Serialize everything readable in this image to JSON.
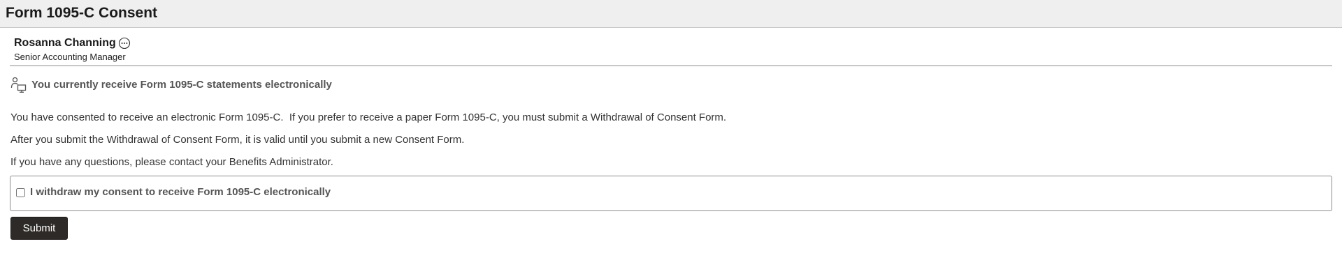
{
  "page": {
    "title": "Form 1095-C Consent"
  },
  "employee": {
    "name": "Rosanna Channing",
    "job_title": "Senior Accounting Manager",
    "more_icon": "ellipsis-circle-icon"
  },
  "status": {
    "icon": "person-computer-icon",
    "text": "You currently receive Form 1095-C statements electronically"
  },
  "body": {
    "paragraphs": [
      "You have consented to receive an electronic Form 1095-C.  If you prefer to receive a paper Form 1095-C, you must submit a Withdrawal of Consent Form.",
      "After you submit the Withdrawal of Consent Form, it is valid until you submit a new Consent Form.",
      "If you have any questions, please contact your Benefits Administrator."
    ]
  },
  "consent": {
    "checkbox_label": "I withdraw my consent to receive Form 1095-C electronically",
    "checked": false
  },
  "actions": {
    "submit_label": "Submit"
  },
  "colors": {
    "title_bar_bg": "#efefef",
    "submit_bg": "#2e2a27",
    "text": "#333333"
  }
}
